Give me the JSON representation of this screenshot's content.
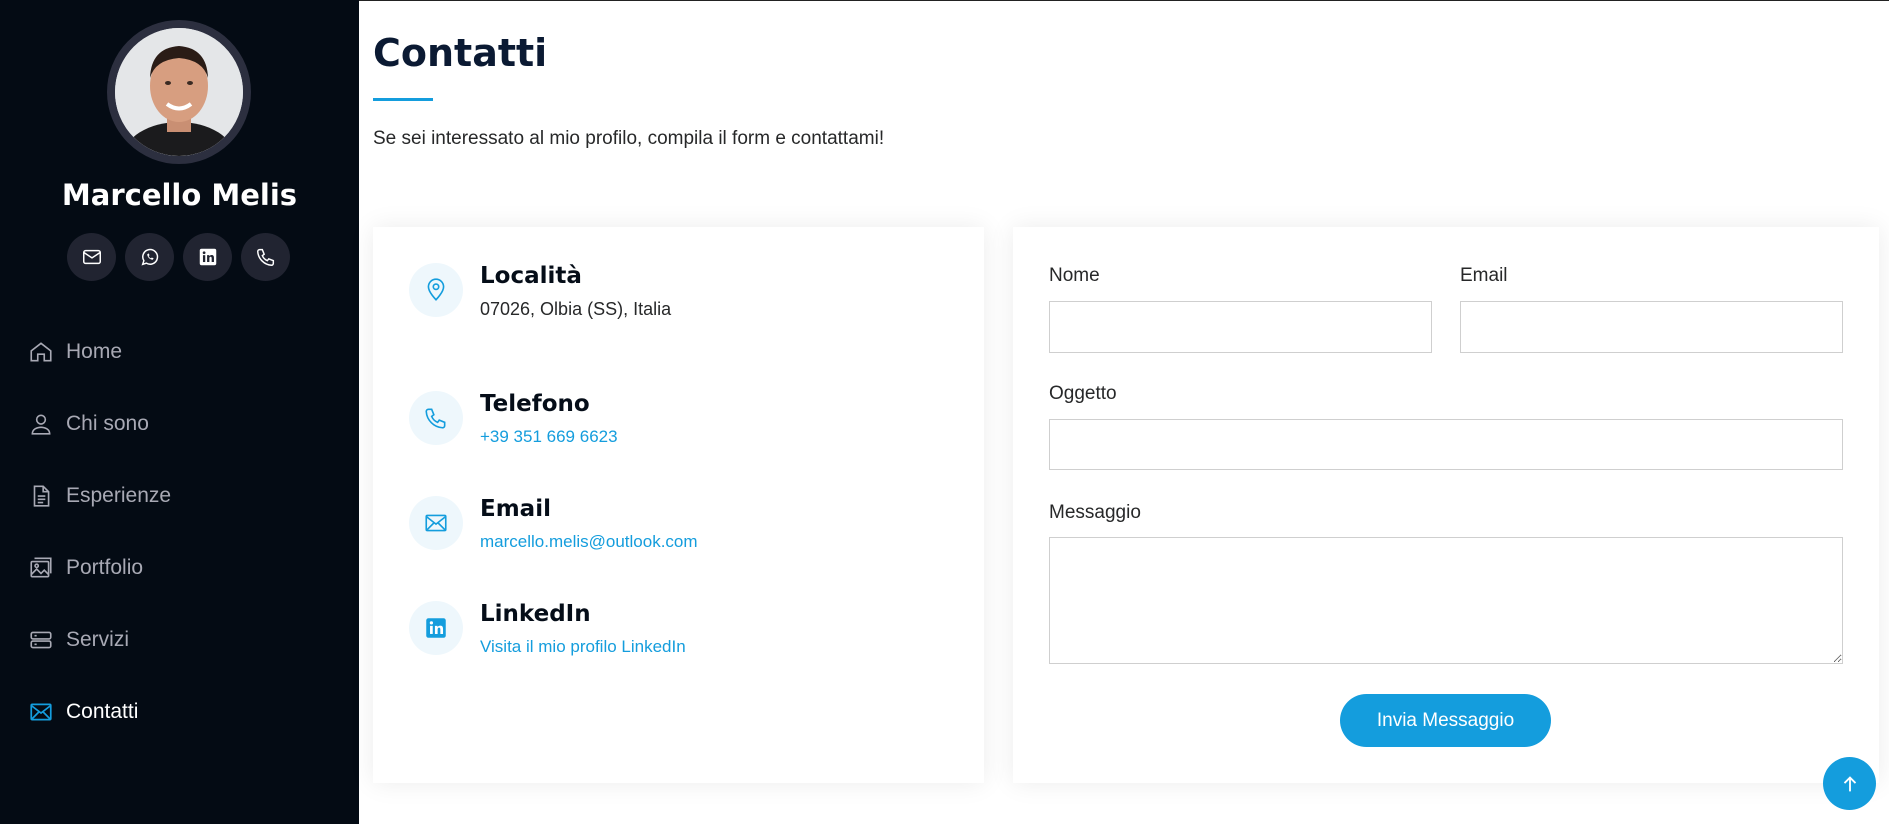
{
  "profile": {
    "name": "Marcello Melis",
    "socials": [
      {
        "icon": "envelope-icon"
      },
      {
        "icon": "whatsapp-icon"
      },
      {
        "icon": "linkedin-icon"
      },
      {
        "icon": "phone-icon"
      }
    ]
  },
  "nav": [
    {
      "label": "Home",
      "icon": "house-icon"
    },
    {
      "label": "Chi sono",
      "icon": "person-icon"
    },
    {
      "label": "Esperienze",
      "icon": "file-text-icon"
    },
    {
      "label": "Portfolio",
      "icon": "images-icon"
    },
    {
      "label": "Servizi",
      "icon": "server-icon"
    },
    {
      "label": "Contatti",
      "icon": "envelope-icon",
      "active": true
    }
  ],
  "section": {
    "title": "Contatti",
    "intro": "Se sei interessato al mio profilo, compila il form e contattami!"
  },
  "info": {
    "location": {
      "title": "Località",
      "text": "07026, Olbia (SS), Italia",
      "icon": "geo-alt-icon"
    },
    "phone": {
      "title": "Telefono",
      "text": "+39 351 669 6623",
      "icon": "phone-icon"
    },
    "email": {
      "title": "Email",
      "text": "marcello.melis@outlook.com",
      "icon": "envelope-icon"
    },
    "linkedin": {
      "title": "LinkedIn",
      "text": "Visita il mio profilo LinkedIn",
      "icon": "linkedin-icon"
    }
  },
  "form": {
    "name_label": "Nome",
    "email_label": "Email",
    "subject_label": "Oggetto",
    "message_label": "Messaggio",
    "name_value": "",
    "email_value": "",
    "subject_value": "",
    "message_value": "",
    "submit_label": "Invia Messaggio"
  },
  "colors": {
    "sidebar_bg": "#040b14",
    "accent": "#149ddd",
    "social_bg": "#212431"
  }
}
